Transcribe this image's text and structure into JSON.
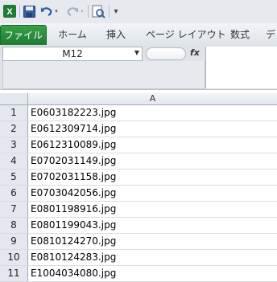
{
  "toolbar": {
    "icons": [
      "excel-icon",
      "save-icon",
      "undo-icon",
      "redo-icon",
      "print-preview-icon",
      "customize-icon"
    ]
  },
  "tabs": {
    "file": "ファイル",
    "home": "ホーム",
    "insert": "挿入",
    "page_layout": "ページ レイアウト",
    "formulas": "数式",
    "partial": "デ"
  },
  "name_box": {
    "value": "M12"
  },
  "formula_bar": {
    "fx_label": "fx",
    "content": ""
  },
  "grid": {
    "column_header": "A",
    "rows": [
      {
        "num": "1",
        "value": "E0603182223.jpg"
      },
      {
        "num": "2",
        "value": "E0612309714.jpg"
      },
      {
        "num": "3",
        "value": "E0612310089.jpg"
      },
      {
        "num": "4",
        "value": "E0702031149.jpg"
      },
      {
        "num": "5",
        "value": "E0702031158.jpg"
      },
      {
        "num": "6",
        "value": "E0703042056.jpg"
      },
      {
        "num": "7",
        "value": "E0801198916.jpg"
      },
      {
        "num": "8",
        "value": "E0801199043.jpg"
      },
      {
        "num": "9",
        "value": "E0810124270.jpg"
      },
      {
        "num": "10",
        "value": "E0810124283.jpg"
      },
      {
        "num": "11",
        "value": "E1004034080.jpg"
      }
    ]
  }
}
